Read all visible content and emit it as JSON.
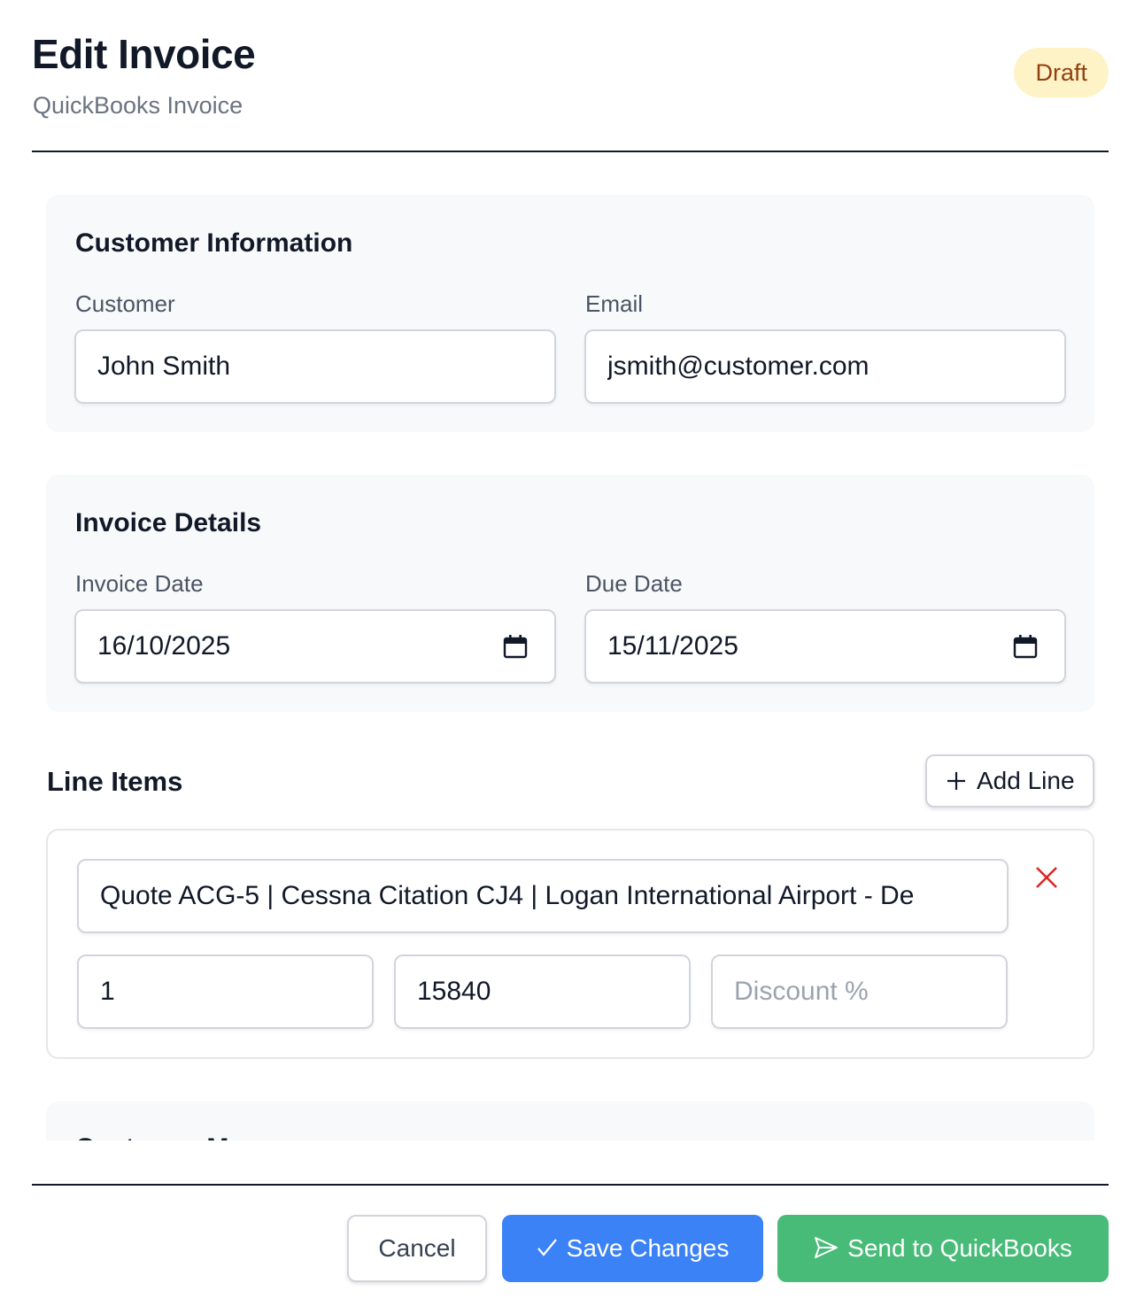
{
  "header": {
    "title": "Edit Invoice",
    "subtitle": "QuickBooks Invoice",
    "status_badge": "Draft"
  },
  "customer_info": {
    "title": "Customer Information",
    "customer_label": "Customer",
    "customer_value": "John Smith",
    "email_label": "Email",
    "email_value": "jsmith@customer.com"
  },
  "invoice_details": {
    "title": "Invoice Details",
    "invoice_date_label": "Invoice Date",
    "invoice_date_value": "16/10/2025",
    "due_date_label": "Due Date",
    "due_date_value": "15/11/2025"
  },
  "line_items": {
    "title": "Line Items",
    "add_line_label": "Add Line",
    "items": [
      {
        "description": "Quote ACG-5 | Cessna Citation CJ4 | Logan International Airport - De",
        "quantity": "1",
        "rate": "15840",
        "discount_placeholder": "Discount %"
      }
    ]
  },
  "next_section_title_partial": "Customer M",
  "footer": {
    "cancel_label": "Cancel",
    "save_label": "Save Changes",
    "send_label": "Send to QuickBooks"
  },
  "icons": [
    "calendar-icon",
    "plus-icon",
    "close-icon",
    "check-icon",
    "send-icon"
  ],
  "colors": {
    "badge_bg": "#fef3c7",
    "badge_text": "#92400e",
    "save_button": "#3b82f6",
    "send_button": "#48bb78",
    "delete_icon": "#dc2626",
    "card_bg": "#f8f9fb"
  }
}
